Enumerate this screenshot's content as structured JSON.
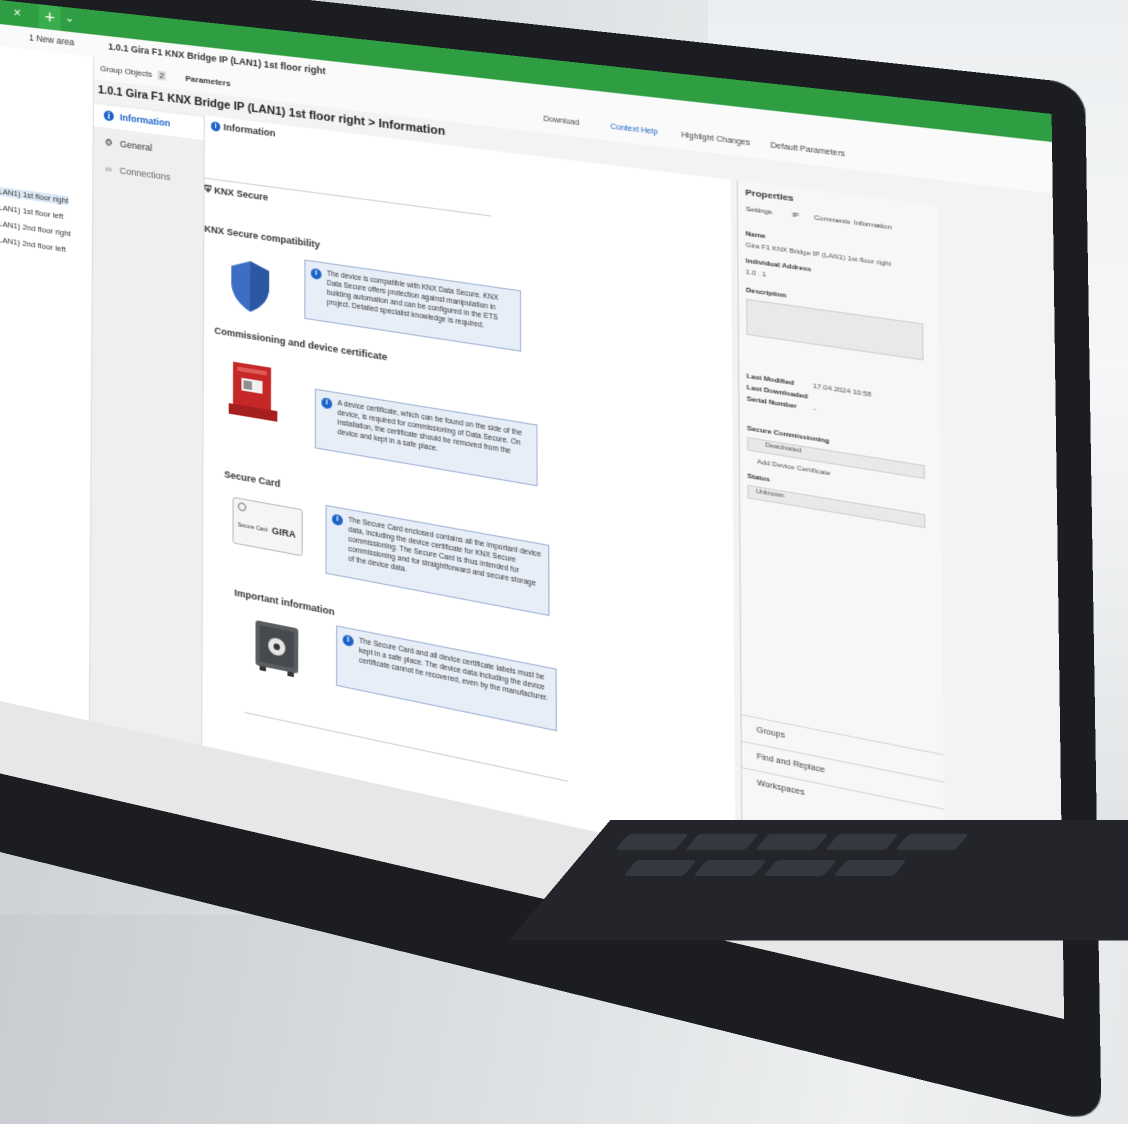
{
  "window": {
    "tab_close": "×",
    "tab_add": "+",
    "tab_menu": "⌄",
    "breadcrumb_area": "1 New area",
    "breadcrumb_device": "1.0.1 Gira F1 KNX Bridge IP (LAN1) 1st floor right"
  },
  "tree": {
    "items": [
      {
        "label": "LAN1) 1st floor right",
        "selected": true
      },
      {
        "label": "LAN1) 1st floor left",
        "selected": false
      },
      {
        "label": "LAN1) 2nd floor right",
        "selected": false
      },
      {
        "label": "LAN1) 2nd floor left",
        "selected": false
      }
    ]
  },
  "subtabs": {
    "group_objects": "Group Objects",
    "group_objects_count": "2",
    "parameters": "Parameters"
  },
  "toolbar": {
    "download": "Download",
    "context_help": "Context Help",
    "highlight_changes": "Highlight Changes",
    "default_parameters": "Default Parameters"
  },
  "device_title": "1.0.1 Gira F1 KNX Bridge IP (LAN1) 1st floor right > Information",
  "param_nav": {
    "items": [
      {
        "label": "Information",
        "icon": "info-icon",
        "active": true
      },
      {
        "label": "General",
        "icon": "gear-icon",
        "active": false
      },
      {
        "label": "Connections",
        "icon": "link-icon",
        "active": false
      }
    ]
  },
  "content": {
    "header": "Information",
    "knx_secure_heading": "KNX Secure",
    "sections": [
      {
        "title": "KNX Secure compatibility",
        "illustration": "shield",
        "text": "The device is compatible with KNX Data Secure. KNX Data Secure offers protection against manipulation in building automation and can be configured in the ETS project. Detailed specialist knowledge is required."
      },
      {
        "title": "Commissioning and device certificate",
        "illustration": "device-certificate",
        "text": "A device certificate, which can be found on the side of the device, is required for commissioning of Data Secure. On installation, the certificate should be removed from the device and kept in a safe place."
      },
      {
        "title": "Secure Card",
        "illustration": "secure-card",
        "text": "The Secure Card enclosed contains all the important device data, including the device certificate for KNX Secure commissioning. The Secure Card is thus intended for commissioning and for straightforward and secure storage of the device data."
      },
      {
        "title": "Important information",
        "illustration": "safe",
        "text": "The Secure Card and all device certificate labels must be kept in a safe place. The device data including the device certificate cannot be recovered, even by the manufacturer."
      }
    ],
    "secure_card_label": "Secure Card",
    "secure_card_brand": "GIRA"
  },
  "properties": {
    "title": "Properties",
    "tabs": [
      "Settings",
      "IP",
      "Comments",
      "Information"
    ],
    "name_label": "Name",
    "name_value": "Gira F1 KNX Bridge IP (LAN1) 1st floor right",
    "individual_address_label": "Individual Address",
    "individual_address_value": "1.0 . 1",
    "description_label": "Description",
    "last_modified_label": "Last Modified",
    "last_modified_value": "17.04.2024 10:58",
    "last_downloaded_label": "Last Downloaded",
    "serial_number_label": "Serial Number",
    "serial_number_value": "-",
    "secure_commissioning_label": "Secure Commissioning",
    "secure_commissioning_value": "Deactivated",
    "add_device_certificate": "Add Device Certificate",
    "status_label": "Status",
    "status_value": "Unknown"
  },
  "side_panels": {
    "groups": "Groups",
    "find_replace": "Find and Replace",
    "workspaces": "Workspaces"
  },
  "colors": {
    "ets_green": "#2f9e43",
    "accent_blue": "#1b63c7",
    "info_box_bg": "#e8eef8",
    "shield_blue": "#3c6fc4",
    "device_red": "#c62828"
  }
}
